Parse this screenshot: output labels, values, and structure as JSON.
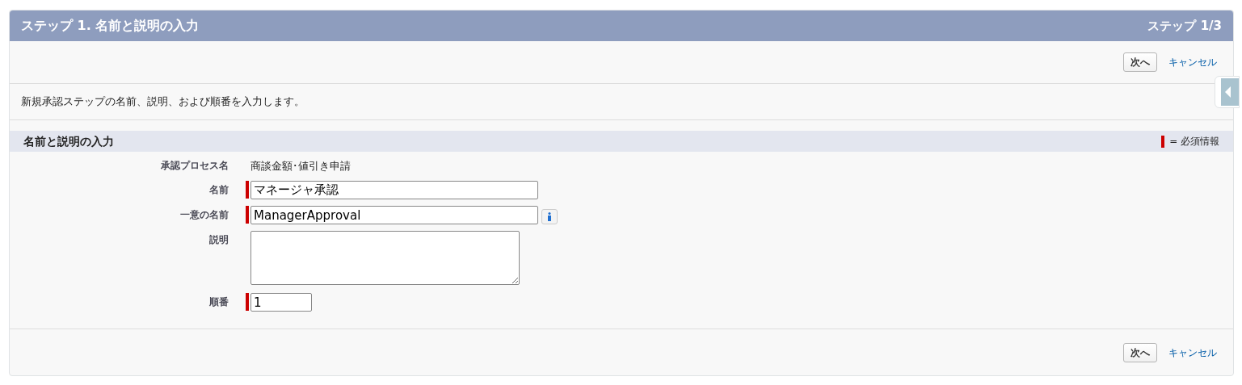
{
  "header": {
    "title": "ステップ 1. 名前と説明の入力",
    "step": "ステップ 1/3"
  },
  "top_buttons": {
    "next": "次へ",
    "cancel": "キャンセル"
  },
  "description": "新規承認ステップの名前、説明、および順番を入力します。",
  "section": {
    "title": "名前と説明の入力",
    "legend": "= 必須情報"
  },
  "fields": [
    {
      "label": "承認プロセス名",
      "kind": "readonly",
      "value": "商談金額･値引き申請",
      "required": false,
      "info": false
    },
    {
      "label": "名前",
      "kind": "text",
      "value": "マネージャ承認",
      "required": true,
      "info": false
    },
    {
      "label": "一意の名前",
      "kind": "text",
      "value": "ManagerApproval",
      "required": true,
      "info": true
    },
    {
      "label": "説明",
      "kind": "textarea",
      "required": false,
      "info": false
    },
    {
      "label": "順番",
      "kind": "short",
      "value": "1",
      "required": true,
      "info": false
    }
  ],
  "bottom_buttons": {
    "next": "次へ",
    "cancel": "キャンセル"
  }
}
